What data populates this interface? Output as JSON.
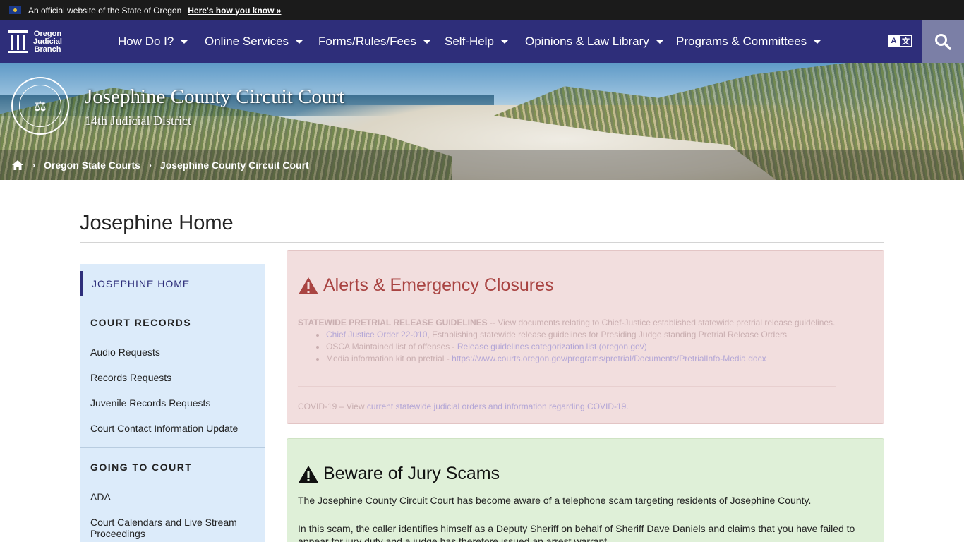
{
  "official_bar": {
    "text": "An official website of the State of Oregon",
    "link": "Here's how you know »"
  },
  "logo": {
    "line1": "Oregon",
    "line2": "Judicial",
    "line3": "Branch"
  },
  "nav": {
    "items": [
      "How Do I?",
      "Online Services",
      "Forms/Rules/Fees",
      "Self-Help",
      "Opinions & Law Library",
      "Programs & Committees"
    ],
    "translate_a": "A",
    "translate_b": "文"
  },
  "hero": {
    "title": "Josephine County Circuit Court",
    "subtitle": "14th Judicial District"
  },
  "breadcrumb": {
    "items": [
      "Oregon State Courts",
      "Josephine County Circuit Court"
    ]
  },
  "page": {
    "title": "Josephine Home"
  },
  "sidebar": {
    "home": "JOSEPHINE HOME",
    "sections": [
      {
        "heading": "COURT RECORDS",
        "links": [
          "Audio Requests",
          "Records Requests",
          "Juvenile Records Requests",
          "Court Contact Information Update"
        ]
      },
      {
        "heading": "GOING TO COURT",
        "links": [
          "ADA",
          "Court Calendars and Live Stream Proceedings"
        ]
      }
    ]
  },
  "alerts": {
    "heading": "Alerts & Emergency Closures",
    "pretrial_label": "STATEWIDE PRETRIAL RELEASE GUIDELINES",
    "pretrial_text": " -- View documents relating to Chief-Justice established statewide pretrial release guidelines.",
    "bullets": [
      {
        "link": "Chief Justice Order 22-010",
        "after": ", Establishing statewide release guidelines for Presiding Judge standing Pretrial Release Orders",
        "before": ""
      },
      {
        "before": "OSCA Maintained list of offenses - ",
        "link": "Release guidelines categorization list (oregon.gov)",
        "after": ""
      },
      {
        "before": "Media information kit on pretrial - ",
        "link": "https://www.courts.oregon.gov/programs/pretrial/Documents/PretrialInfo-Media.docx",
        "after": ""
      }
    ],
    "covid_prefix": "COVID-19 – View ",
    "covid_link": "current statewide judicial orders and information regarding COVID-19."
  },
  "scam": {
    "heading": "Beware of Jury Scams",
    "p1": "The Josephine County Circuit Court has become aware of a telephone scam targeting residents of Josephine County.",
    "p2": "In this scam, the caller identifies himself as a Deputy Sheriff on behalf of Sheriff Dave Daniels and claims that you have failed to appear for jury duty and a judge has therefore issued an arrest warrant."
  },
  "colors": {
    "nav_bg": "#2e2e7a",
    "alert_red": "#a94442",
    "alert_bg": "#f2dede",
    "success_bg": "#dff0d8",
    "sidebar_bg": "#dcebfa"
  }
}
